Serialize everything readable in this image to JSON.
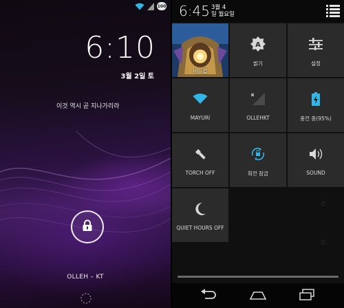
{
  "lock_screen": {
    "status_badge": "100",
    "clock": "6:10",
    "date": "3월 2일 토",
    "owner_info": "이것 역시 곧 지나가리라",
    "carrier": "OLLEH – KT"
  },
  "quick_settings": {
    "clock": "6:45",
    "date_line1": "3월 4",
    "date_line2": "일 월요일",
    "tiles": [
      {
        "label": "비누갑"
      },
      {
        "label": "밝기"
      },
      {
        "label": "설정"
      },
      {
        "label": "MAYURI"
      },
      {
        "label": "OLLEHKT"
      },
      {
        "label": "충전 중(95%)"
      },
      {
        "label": "TORCH OFF"
      },
      {
        "label": "회전 잠금"
      },
      {
        "label": "SOUND"
      },
      {
        "label": "QUIET HOURS OFF"
      }
    ]
  },
  "colors": {
    "accent_blue": "#33b5e5",
    "tile_bg": "#2b2b2b"
  },
  "icons": {
    "lock": "lock-icon",
    "wifi": "wifi-icon",
    "brightness": "brightness-auto-icon",
    "settings": "sliders-icon",
    "signal": "signal-icon",
    "battery": "battery-charging-icon",
    "torch": "flashlight-icon",
    "rotation": "rotation-lock-icon",
    "sound": "speaker-icon",
    "quiet": "moon-icon",
    "back": "back-icon",
    "home": "home-icon",
    "recents": "recents-icon"
  }
}
